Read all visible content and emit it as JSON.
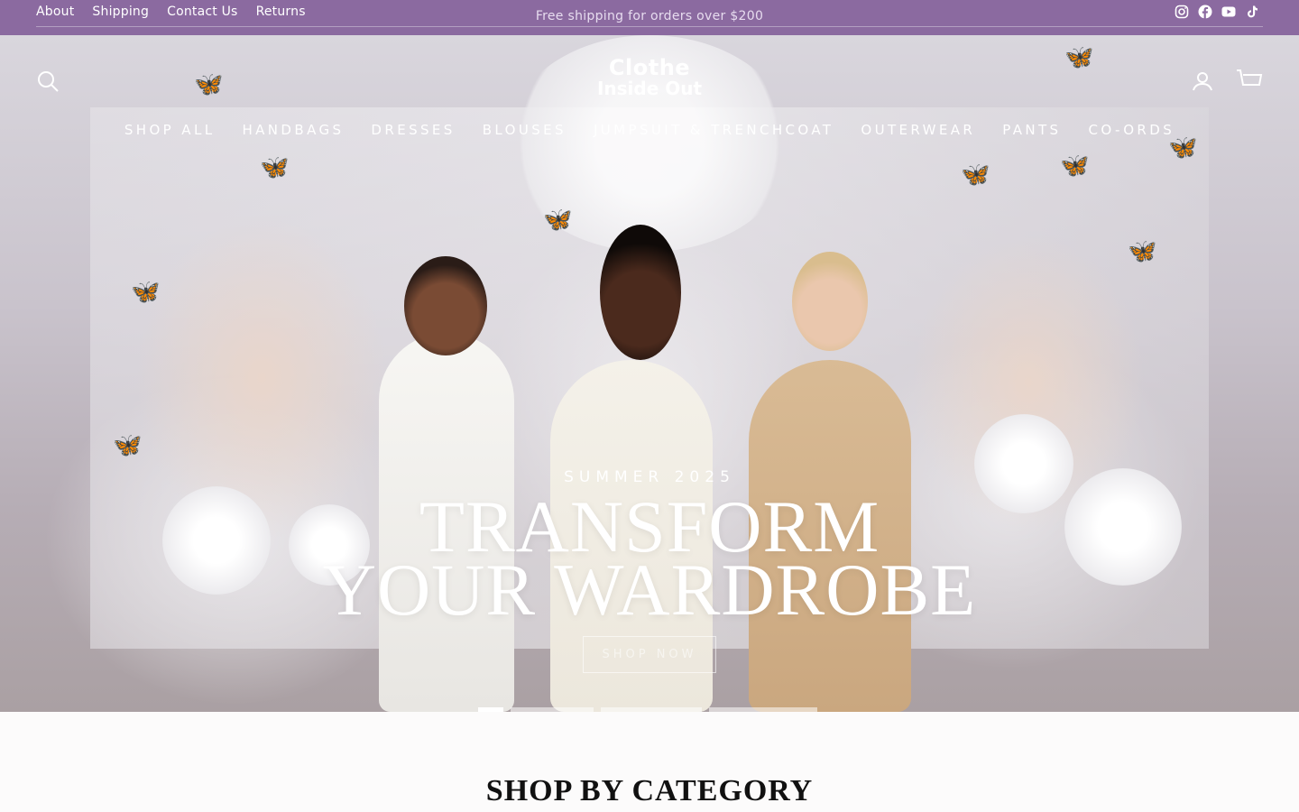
{
  "topbar": {
    "links": [
      "About",
      "Shipping",
      "Contact Us",
      "Returns"
    ],
    "promo": "Free shipping for orders over $200",
    "social": [
      "instagram-icon",
      "facebook-icon",
      "youtube-icon",
      "tiktok-icon"
    ],
    "bg_color": "#8b6aa0"
  },
  "header": {
    "logo_line1": "Clothe",
    "logo_line2": "Inside Out",
    "icons": [
      "search-icon",
      "account-icon",
      "cart-icon"
    ]
  },
  "nav": {
    "items": [
      "SHOP ALL",
      "HANDBAGS",
      "DRESSES",
      "BLOUSES",
      "JUMPSUIT & TRENCHCOAT",
      "OUTERWEAR",
      "PANTS",
      "CO-ORDS"
    ]
  },
  "hero": {
    "eyebrow": "SUMMER 2025",
    "title_line1": "TRANSFORM",
    "title_line2": "YOUR WARDROBE",
    "cta": "SHOP NOW",
    "slides": 4,
    "active_slide": 1
  },
  "section": {
    "title": "SHOP BY CATEGORY"
  }
}
